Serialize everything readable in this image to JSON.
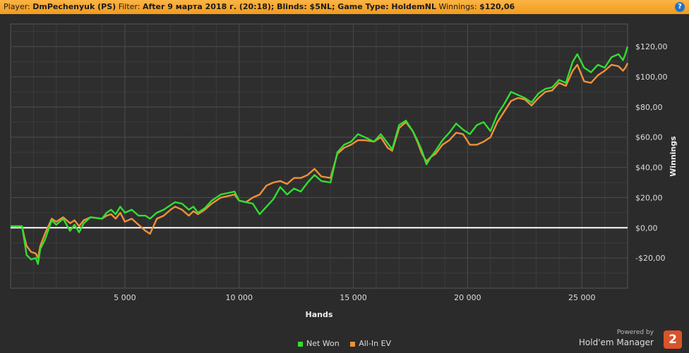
{
  "header": {
    "player_label": "Player:",
    "player": "DmPechenyuk (PS)",
    "filter_label": "Filter:",
    "filter": "After 9 марта 2018 г. (20:18); Blinds: $5NL; Game Type: HoldemNL",
    "winnings_label": "Winnings:",
    "winnings": "$120,06",
    "help": "?"
  },
  "chart_data": {
    "type": "line",
    "xlabel": "Hands",
    "ylabel": "Winnings",
    "xlim": [
      0,
      27000
    ],
    "ylim": [
      -40,
      135
    ],
    "x_ticks": [
      5000,
      10000,
      15000,
      20000,
      25000
    ],
    "x_tick_labels": [
      "5 000",
      "10 000",
      "15 000",
      "20 000",
      "25 000"
    ],
    "y_ticks": [
      -20,
      0,
      20,
      40,
      60,
      80,
      100,
      120
    ],
    "y_tick_labels": [
      "-$20,00",
      "$0,00",
      "$20,00",
      "$40,00",
      "$60,00",
      "$80,00",
      "$100,00",
      "$120,00"
    ],
    "grid": true,
    "legend": "bottom",
    "series": [
      {
        "name": "Net Won",
        "color": "#33dd33",
        "points": [
          [
            0,
            1
          ],
          [
            300,
            1
          ],
          [
            500,
            1
          ],
          [
            600,
            -8
          ],
          [
            700,
            -18
          ],
          [
            900,
            -21
          ],
          [
            1100,
            -20
          ],
          [
            1200,
            -24
          ],
          [
            1300,
            -14
          ],
          [
            1500,
            -8
          ],
          [
            1800,
            5
          ],
          [
            2000,
            2
          ],
          [
            2300,
            6
          ],
          [
            2600,
            -2
          ],
          [
            2800,
            2
          ],
          [
            3000,
            -3
          ],
          [
            3200,
            3
          ],
          [
            3500,
            7
          ],
          [
            4000,
            6
          ],
          [
            4200,
            10
          ],
          [
            4400,
            12
          ],
          [
            4600,
            9
          ],
          [
            4800,
            14
          ],
          [
            5000,
            10
          ],
          [
            5300,
            12
          ],
          [
            5600,
            8
          ],
          [
            5900,
            8
          ],
          [
            6100,
            6
          ],
          [
            6400,
            10
          ],
          [
            6700,
            12
          ],
          [
            7000,
            15
          ],
          [
            7200,
            17
          ],
          [
            7500,
            16
          ],
          [
            7800,
            12
          ],
          [
            8000,
            14
          ],
          [
            8200,
            10
          ],
          [
            8500,
            13
          ],
          [
            8800,
            18
          ],
          [
            9200,
            22
          ],
          [
            9500,
            23
          ],
          [
            9800,
            24
          ],
          [
            10000,
            18
          ],
          [
            10300,
            17
          ],
          [
            10600,
            16
          ],
          [
            10900,
            9
          ],
          [
            11200,
            14
          ],
          [
            11500,
            19
          ],
          [
            11800,
            27
          ],
          [
            12100,
            22
          ],
          [
            12400,
            26
          ],
          [
            12700,
            24
          ],
          [
            13000,
            30
          ],
          [
            13300,
            35
          ],
          [
            13600,
            31
          ],
          [
            14000,
            30
          ],
          [
            14300,
            50
          ],
          [
            14600,
            55
          ],
          [
            14900,
            57
          ],
          [
            15200,
            62
          ],
          [
            15500,
            60
          ],
          [
            15900,
            57
          ],
          [
            16200,
            62
          ],
          [
            16500,
            56
          ],
          [
            16700,
            52
          ],
          [
            17000,
            68
          ],
          [
            17300,
            71
          ],
          [
            17600,
            64
          ],
          [
            17800,
            58
          ],
          [
            18000,
            51
          ],
          [
            18200,
            42
          ],
          [
            18400,
            47
          ],
          [
            18600,
            51
          ],
          [
            18900,
            58
          ],
          [
            19200,
            63
          ],
          [
            19500,
            69
          ],
          [
            19800,
            65
          ],
          [
            20100,
            62
          ],
          [
            20400,
            68
          ],
          [
            20700,
            70
          ],
          [
            21000,
            64
          ],
          [
            21300,
            75
          ],
          [
            21600,
            82
          ],
          [
            21900,
            90
          ],
          [
            22200,
            88
          ],
          [
            22500,
            86
          ],
          [
            22800,
            83
          ],
          [
            23100,
            89
          ],
          [
            23400,
            92
          ],
          [
            23700,
            93
          ],
          [
            24000,
            98
          ],
          [
            24300,
            96
          ],
          [
            24600,
            110
          ],
          [
            24800,
            115
          ],
          [
            25100,
            106
          ],
          [
            25400,
            103
          ],
          [
            25700,
            108
          ],
          [
            26000,
            106
          ],
          [
            26300,
            113
          ],
          [
            26600,
            115
          ],
          [
            26800,
            111
          ],
          [
            26900,
            115
          ],
          [
            27000,
            120
          ]
        ]
      },
      {
        "name": "All-In EV",
        "color": "#f0913a",
        "points": [
          [
            0,
            1
          ],
          [
            300,
            1
          ],
          [
            500,
            1
          ],
          [
            600,
            -6
          ],
          [
            700,
            -12
          ],
          [
            900,
            -16
          ],
          [
            1100,
            -17
          ],
          [
            1200,
            -20
          ],
          [
            1300,
            -12
          ],
          [
            1500,
            -4
          ],
          [
            1800,
            6
          ],
          [
            2000,
            4
          ],
          [
            2300,
            7
          ],
          [
            2600,
            3
          ],
          [
            2800,
            5
          ],
          [
            3000,
            1
          ],
          [
            3200,
            5
          ],
          [
            3500,
            7
          ],
          [
            4000,
            6
          ],
          [
            4200,
            8
          ],
          [
            4400,
            9
          ],
          [
            4600,
            6
          ],
          [
            4800,
            10
          ],
          [
            5000,
            4
          ],
          [
            5300,
            6
          ],
          [
            5600,
            2
          ],
          [
            5900,
            -2
          ],
          [
            6100,
            -4
          ],
          [
            6400,
            6
          ],
          [
            6700,
            8
          ],
          [
            7000,
            12
          ],
          [
            7200,
            14
          ],
          [
            7500,
            12
          ],
          [
            7800,
            8
          ],
          [
            8000,
            11
          ],
          [
            8200,
            9
          ],
          [
            8500,
            12
          ],
          [
            8800,
            16
          ],
          [
            9200,
            20
          ],
          [
            9500,
            21
          ],
          [
            9800,
            22
          ],
          [
            10000,
            18
          ],
          [
            10300,
            17
          ],
          [
            10600,
            20
          ],
          [
            10900,
            22
          ],
          [
            11200,
            28
          ],
          [
            11500,
            30
          ],
          [
            11800,
            31
          ],
          [
            12100,
            29
          ],
          [
            12400,
            33
          ],
          [
            12700,
            33
          ],
          [
            13000,
            35
          ],
          [
            13300,
            39
          ],
          [
            13600,
            34
          ],
          [
            14000,
            33
          ],
          [
            14300,
            49
          ],
          [
            14600,
            53
          ],
          [
            14900,
            55
          ],
          [
            15200,
            58
          ],
          [
            15500,
            58
          ],
          [
            15900,
            57
          ],
          [
            16200,
            60
          ],
          [
            16500,
            53
          ],
          [
            16700,
            51
          ],
          [
            17000,
            66
          ],
          [
            17300,
            70
          ],
          [
            17600,
            64
          ],
          [
            17800,
            57
          ],
          [
            18000,
            49
          ],
          [
            18200,
            44
          ],
          [
            18400,
            47
          ],
          [
            18600,
            49
          ],
          [
            18900,
            55
          ],
          [
            19200,
            58
          ],
          [
            19500,
            63
          ],
          [
            19800,
            62
          ],
          [
            20100,
            55
          ],
          [
            20400,
            55
          ],
          [
            20700,
            57
          ],
          [
            21000,
            60
          ],
          [
            21300,
            70
          ],
          [
            21600,
            77
          ],
          [
            21900,
            84
          ],
          [
            22200,
            86
          ],
          [
            22500,
            85
          ],
          [
            22800,
            81
          ],
          [
            23100,
            86
          ],
          [
            23400,
            90
          ],
          [
            23700,
            91
          ],
          [
            24000,
            96
          ],
          [
            24300,
            94
          ],
          [
            24600,
            104
          ],
          [
            24800,
            108
          ],
          [
            25100,
            97
          ],
          [
            25400,
            96
          ],
          [
            25700,
            101
          ],
          [
            26000,
            104
          ],
          [
            26300,
            108
          ],
          [
            26600,
            107
          ],
          [
            26800,
            104
          ],
          [
            26900,
            106
          ],
          [
            27000,
            109
          ]
        ]
      }
    ]
  },
  "branding": {
    "powered_by": "Powered by",
    "product": "Hold'em Manager",
    "badge": "2"
  }
}
